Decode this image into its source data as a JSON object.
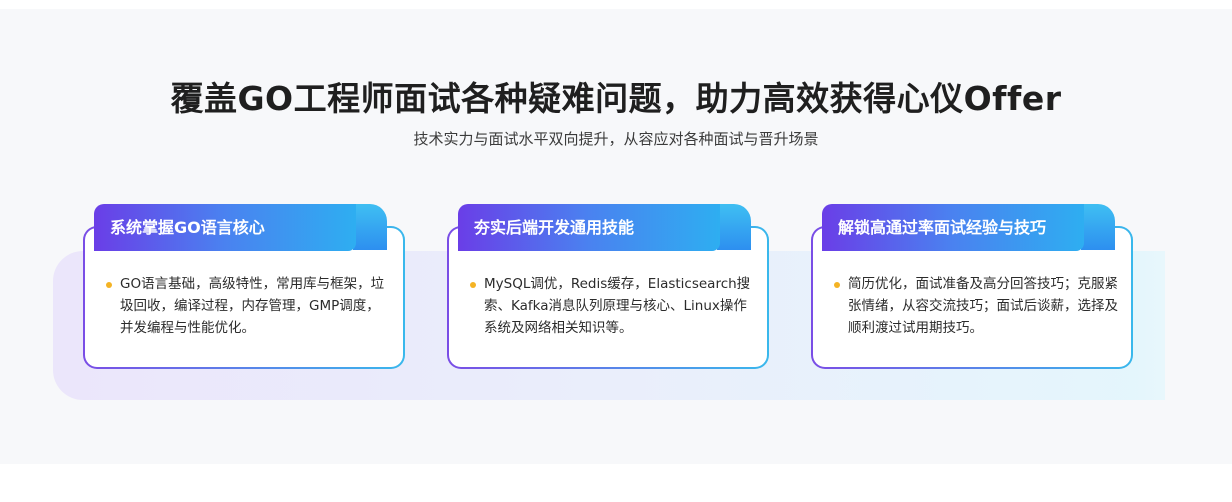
{
  "header": {
    "title": "覆盖GO工程师面试各种疑难问题，助力高效获得心仪Offer",
    "subtitle": "技术实力与面试水平双向提升，从容应对各种面试与晋升场景"
  },
  "cards": [
    {
      "title": "系统掌握GO语言核心",
      "description": "GO语言基础，高级特性，常用库与框架，垃圾回收，编译过程，内存管理，GMP调度，并发编程与性能优化。"
    },
    {
      "title": "夯实后端开发通用技能",
      "description": "MySQL调优，Redis缓存，Elasticsearch搜索、Kafka消息队列原理与核心、Linux操作系统及网络相关知识等。"
    },
    {
      "title": "解锁高通过率面试经验与技巧",
      "description": "简历优化，面试准备及高分回答技巧；克服紧张情绪，从容交流技巧；面试后谈薪，选择及顺利渡过试用期技巧。"
    }
  ],
  "colors": {
    "bullet": "#f4b324",
    "tab_start": "#6a3ee7",
    "tab_end": "#2eaef1"
  }
}
